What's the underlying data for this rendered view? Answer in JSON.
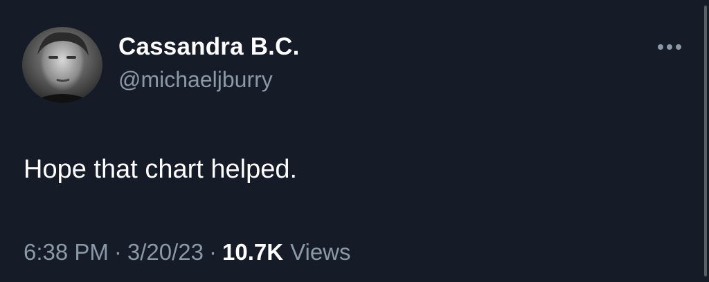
{
  "author": {
    "display_name": "Cassandra B.C.",
    "handle": "@michaeljburry"
  },
  "tweet": {
    "text": "Hope that chart helped."
  },
  "meta": {
    "time": "6:38 PM",
    "separator": "·",
    "date": "3/20/23",
    "views_count": "10.7K",
    "views_label": "Views"
  },
  "icons": {
    "more": "more-horizontal-icon",
    "avatar": "avatar"
  },
  "colors": {
    "background": "#151b27",
    "primary_text": "#ffffff",
    "secondary_text": "#8b98a5"
  }
}
